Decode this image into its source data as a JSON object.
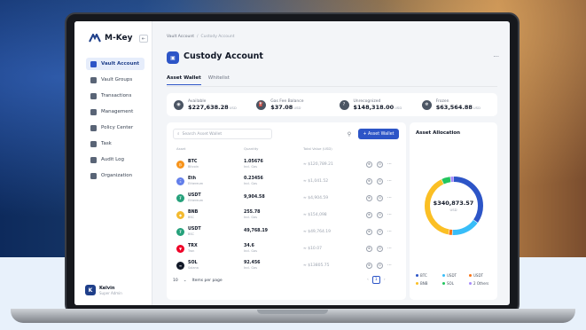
{
  "brand": {
    "name": "M-Key",
    "collapse_icon": "⇤"
  },
  "sidebar": {
    "items": [
      {
        "label": "Vault Account",
        "icon": "wallet-icon",
        "active": true
      },
      {
        "label": "Vault Groups",
        "icon": "folder-icon",
        "active": false
      },
      {
        "label": "Transactions",
        "icon": "transactions-icon",
        "active": false
      },
      {
        "label": "Management",
        "icon": "management-icon",
        "active": false
      },
      {
        "label": "Policy Center",
        "icon": "shield-icon",
        "active": false
      },
      {
        "label": "Task",
        "icon": "task-icon",
        "active": false
      },
      {
        "label": "Audit Log",
        "icon": "audit-icon",
        "active": false
      },
      {
        "label": "Organization",
        "icon": "users-icon",
        "active": false
      }
    ],
    "user": {
      "initial": "K",
      "name": "Kelvin",
      "role": "Super Admin"
    }
  },
  "header": {
    "breadcrumb": [
      "Vault Account",
      "Custody Account"
    ],
    "separator": "/",
    "title": "Custody Account",
    "more": "···"
  },
  "tabs": [
    {
      "label": "Asset Wallet",
      "active": true
    },
    {
      "label": "Whitelist",
      "active": false
    }
  ],
  "stats": [
    {
      "label": "Available",
      "value": "$227,638.28",
      "unit": "USD"
    },
    {
      "label": "Gas Fee Balance",
      "value": "$37.08",
      "unit": "USD"
    },
    {
      "label": "Unrecognized",
      "value": "$148,318.00",
      "unit": "USD"
    },
    {
      "label": "Frozen",
      "value": "$63,564.88",
      "unit": "USD"
    }
  ],
  "assets": {
    "search_placeholder": "Search Asset Wallet",
    "add_button": "+ Asset Wallet",
    "columns": [
      "Asset",
      "Quantity",
      "Total Value (USD)"
    ],
    "rows": [
      {
        "symbol": "BTC",
        "network": "Bitcoin",
        "qty": "1.05676",
        "qty_sub": "Incl. Gas",
        "total": "≈ $120,789.21",
        "color": "#f7931a",
        "glyph": "₿"
      },
      {
        "symbol": "Eth",
        "network": "Ethereum",
        "qty": "0.23456",
        "qty_sub": "Incl. Gas",
        "total": "≈ $1,041.52",
        "color": "#627eea",
        "glyph": "Ξ"
      },
      {
        "symbol": "USDT",
        "network": "Ethereum",
        "qty": "9,904.58",
        "qty_sub": "",
        "total": "≈ $4,904.59",
        "color": "#26a17b",
        "glyph": "₮"
      },
      {
        "symbol": "BNB",
        "network": "BSC",
        "qty": "255.78",
        "qty_sub": "Incl. Gas",
        "total": "≈ $154,098",
        "color": "#f3ba2f",
        "glyph": "◆"
      },
      {
        "symbol": "USDT",
        "network": "BSC",
        "qty": "49,768.19",
        "qty_sub": "",
        "total": "≈ $49,764.19",
        "color": "#26a17b",
        "glyph": "₮"
      },
      {
        "symbol": "TRX",
        "network": "Tron",
        "qty": "34.6",
        "qty_sub": "Incl. Gas",
        "total": "≈ $10.07",
        "color": "#ef0027",
        "glyph": "▼"
      },
      {
        "symbol": "SOL",
        "network": "Solana",
        "qty": "92.456",
        "qty_sub": "Incl. Gas",
        "total": "≈ $13805.75",
        "color": "#111827",
        "glyph": "≡"
      }
    ],
    "per_page": "10",
    "per_page_label": "Items per page",
    "current_page": "1",
    "prev": "‹",
    "next": "›"
  },
  "allocation": {
    "title": "Asset Allocation",
    "total": "$340,873.57",
    "unit": "USD",
    "segments": [
      {
        "name": "BTC",
        "share": 0.35,
        "color": "#2d55c7"
      },
      {
        "name": "USDT",
        "share": 0.16,
        "color": "#38bdf8"
      },
      {
        "name": "USDT",
        "share": 0.02,
        "color": "#f97316"
      },
      {
        "name": "BNB",
        "share": 0.4,
        "color": "#fbbf24"
      },
      {
        "name": "SOL",
        "share": 0.05,
        "color": "#22c55e"
      },
      {
        "name": "2 Others",
        "share": 0.02,
        "color": "#a78bfa"
      }
    ]
  }
}
